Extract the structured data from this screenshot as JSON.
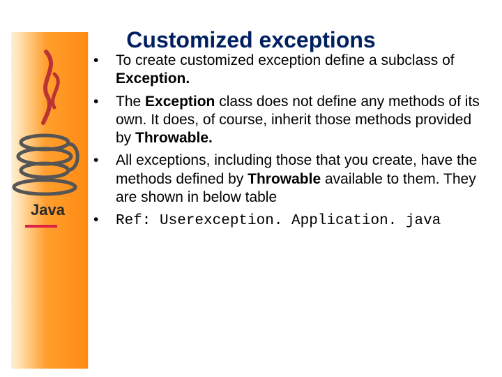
{
  "title": "Customized exceptions",
  "bullets": {
    "b1": {
      "pre": "To create customized exception define a subclass of ",
      "strong": "Exception.",
      "post": ""
    },
    "b2": {
      "p1": "The ",
      "s1": "Exception ",
      "p2": "class does not define any methods of its own. It does, of course, inherit those methods provided by ",
      "s2": "Throwable.",
      "p3": ""
    },
    "b3": {
      "p1": "All exceptions, including those that you create, have the methods defined by ",
      "s1": "Throwable",
      "p2": " available to them. They are shown in below table"
    },
    "b4": {
      "label": "Ref: ",
      "code": "Userexception. Application. java"
    }
  },
  "sidebar": {
    "logo_label": "Java",
    "icon": "java-cup-icon"
  }
}
